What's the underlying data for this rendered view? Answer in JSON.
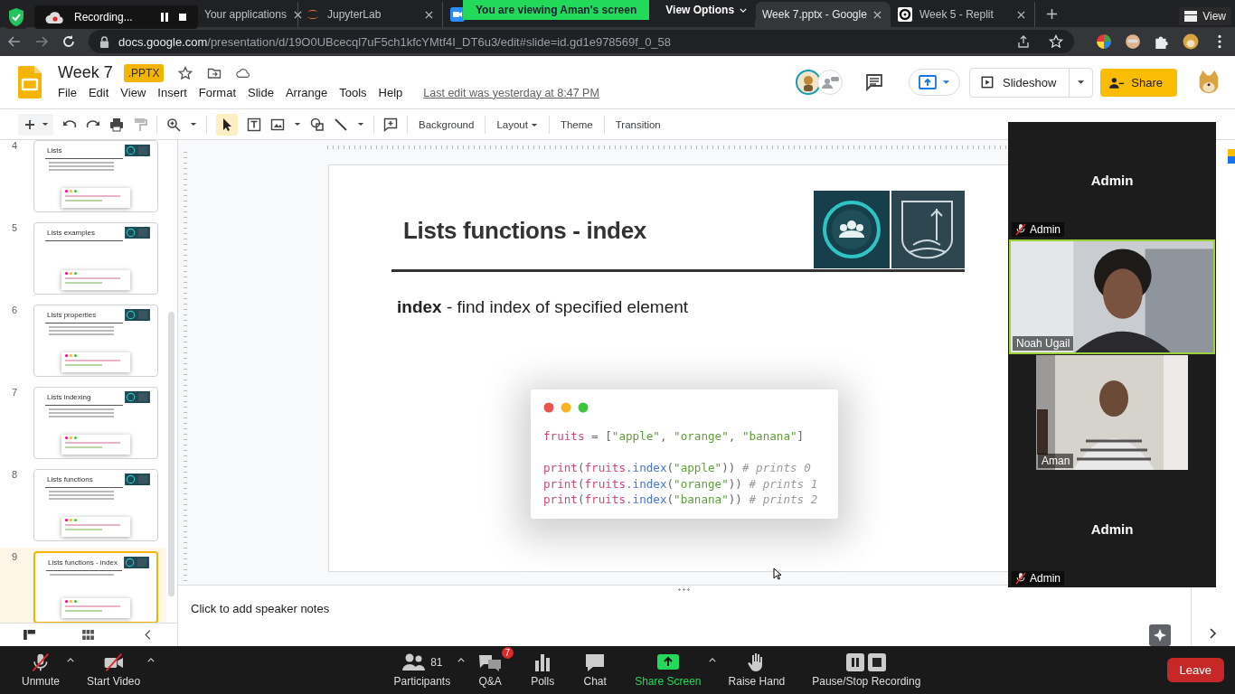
{
  "zoom_overlay": {
    "recording": "Recording...",
    "banner": "You are viewing Aman's screen",
    "view_options": "View Options",
    "view": "View"
  },
  "browser": {
    "tabs": [
      {
        "title": "Your applications",
        "selected": false
      },
      {
        "title": "JupyterLab",
        "selected": false
      },
      {
        "title": "Week 7.pptx - Google",
        "selected": true
      },
      {
        "title": "Week 5 - Replit",
        "selected": false
      }
    ],
    "url_host": "docs.google.com",
    "url_path": "/presentation/d/19O0UBcecql7uF5ch1kfcYMtf4I_DT6u3/edit#slide=id.gd1e978569f_0_58"
  },
  "doc": {
    "title": "Week 7",
    "badge": ".PPTX",
    "menu": [
      "File",
      "Edit",
      "View",
      "Insert",
      "Format",
      "Slide",
      "Arrange",
      "Tools",
      "Help"
    ],
    "last_edit": "Last edit was yesterday at 8:47 PM",
    "slideshow": "Slideshow",
    "share": "Share"
  },
  "toolbar": {
    "buttons": [
      {
        "label": "Background",
        "dropdown": false
      },
      {
        "label": "Layout",
        "dropdown": true
      },
      {
        "label": "Theme",
        "dropdown": false
      },
      {
        "label": "Transition",
        "dropdown": false
      }
    ]
  },
  "slides": [
    {
      "number": "4",
      "title": "Lists",
      "selected": false
    },
    {
      "number": "5",
      "title": "Lists examples",
      "selected": false
    },
    {
      "number": "6",
      "title": "Lists properties",
      "selected": false
    },
    {
      "number": "7",
      "title": "Lists indexing",
      "selected": false
    },
    {
      "number": "8",
      "title": "Lists functions",
      "selected": false
    },
    {
      "number": "9",
      "title": "Lists functions - index",
      "selected": true
    }
  ],
  "slide": {
    "title": "Lists functions - index",
    "body": "**index** - find index of specified element",
    "code": [
      {
        "gap_before": false,
        "tokens": [
          {
            "text": "fruits",
            "kind": "var"
          },
          {
            "text": " = [",
            "kind": "punct"
          },
          {
            "text": "\"apple\"",
            "kind": "str"
          },
          {
            "text": ", ",
            "kind": "punct"
          },
          {
            "text": "\"orange\"",
            "kind": "str"
          },
          {
            "text": ", ",
            "kind": "punct"
          },
          {
            "text": "\"banana\"",
            "kind": "str"
          },
          {
            "text": "]",
            "kind": "punct"
          }
        ]
      },
      {
        "gap_before": true,
        "tokens": [
          {
            "text": "print",
            "kind": "var"
          },
          {
            "text": "(",
            "kind": "punct"
          },
          {
            "text": "fruits",
            "kind": "var"
          },
          {
            "text": ".index",
            "kind": "fn"
          },
          {
            "text": "(",
            "kind": "punct"
          },
          {
            "text": "\"apple\"",
            "kind": "str"
          },
          {
            "text": ")) ",
            "kind": "punct"
          },
          {
            "text": "# prints 0",
            "kind": "comment"
          }
        ]
      },
      {
        "gap_before": false,
        "tokens": [
          {
            "text": "print",
            "kind": "var"
          },
          {
            "text": "(",
            "kind": "punct"
          },
          {
            "text": "fruits",
            "kind": "var"
          },
          {
            "text": ".index",
            "kind": "fn"
          },
          {
            "text": "(",
            "kind": "punct"
          },
          {
            "text": "\"orange\"",
            "kind": "str"
          },
          {
            "text": ")) ",
            "kind": "punct"
          },
          {
            "text": "# prints 1",
            "kind": "comment"
          }
        ]
      },
      {
        "gap_before": false,
        "tokens": [
          {
            "text": "print",
            "kind": "var"
          },
          {
            "text": "(",
            "kind": "punct"
          },
          {
            "text": "fruits",
            "kind": "var"
          },
          {
            "text": ".index",
            "kind": "fn"
          },
          {
            "text": "(",
            "kind": "punct"
          },
          {
            "text": "\"banana\"",
            "kind": "str"
          },
          {
            "text": ")) ",
            "kind": "punct"
          },
          {
            "text": "# prints 2",
            "kind": "comment"
          }
        ]
      }
    ]
  },
  "notes": {
    "placeholder": "Click to add speaker notes"
  },
  "video_tiles": [
    {
      "kind": "name",
      "name": "Admin",
      "label": "Admin",
      "muted": true
    },
    {
      "kind": "video",
      "label": "Noah Ugail",
      "speaking": true
    },
    {
      "kind": "video",
      "label": "Aman",
      "speaking": false
    },
    {
      "kind": "name",
      "name": "Admin",
      "label": "Admin",
      "muted": true
    }
  ],
  "meeting_bar": {
    "left": [
      {
        "kind": "mic",
        "label": "Unmute",
        "off": true
      },
      {
        "kind": "camera",
        "label": "Start Video",
        "off": true
      }
    ],
    "center": [
      {
        "kind": "participants",
        "label": "Participants",
        "count": "81",
        "caret": true
      },
      {
        "kind": "qa",
        "label": "Q&A",
        "badge": "7",
        "caret": false
      },
      {
        "kind": "polls",
        "label": "Polls",
        "caret": false
      },
      {
        "kind": "chat",
        "label": "Chat",
        "caret": false
      },
      {
        "kind": "share",
        "label": "Share Screen",
        "caret": true
      },
      {
        "kind": "hand",
        "label": "Raise Hand",
        "caret": false
      },
      {
        "kind": "record",
        "label": "Pause/Stop Recording",
        "caret": false
      }
    ],
    "leave": "Leave"
  }
}
